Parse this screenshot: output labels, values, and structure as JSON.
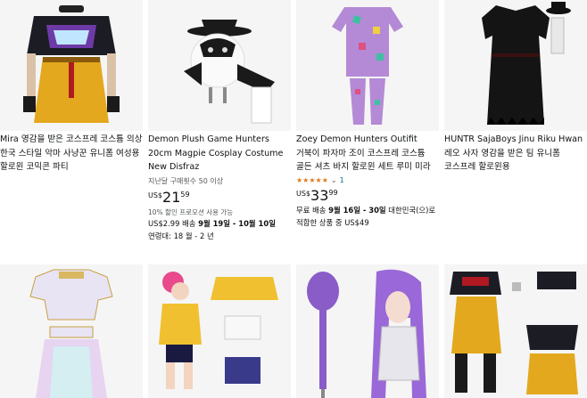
{
  "products": [
    {
      "title": "Mira 영감을 받은 코스프레 코스튬 의상 한국 스타일 악마 사냥꾼 유니폼 여성용 할로윈 코믹콘 파티"
    },
    {
      "title": "Demon Plush Game Hunters 20cm Magpie Cosplay Costume New Disfraz",
      "purchases": "지난달 구매횟수 50 이상",
      "currency": "US$",
      "price_whole": "21",
      "price_fraction": "59",
      "promo": "10% 할인 프로모션 사용 가능",
      "shipping_prefix": "US$2.99 배송 ",
      "shipping_dates": "9월 19일 - 10월 10일",
      "age": "연령대: 18 월 - 2 년"
    },
    {
      "title": "Zoey Demon Hunters Outifit 거북이 파자마 조이 코스프레 코스튬 골든 셔츠 바지 할로윈 세트 루미 미라",
      "rating_stars": "★★★★★",
      "rating_count": "1",
      "currency": "US$",
      "price_whole": "33",
      "price_fraction": "99",
      "shipping_prefix": "무료 배송 ",
      "shipping_dates": "9월 16일 - 30일",
      "shipping_suffix": " 대한민국(으)로 적합한 상품 중 US$49"
    },
    {
      "title": "HUNTR SajaBoys Jinu Riku Hwan 레오 사자 영감을 받은 팀 유니폼 코스프레 할로윈용"
    }
  ]
}
